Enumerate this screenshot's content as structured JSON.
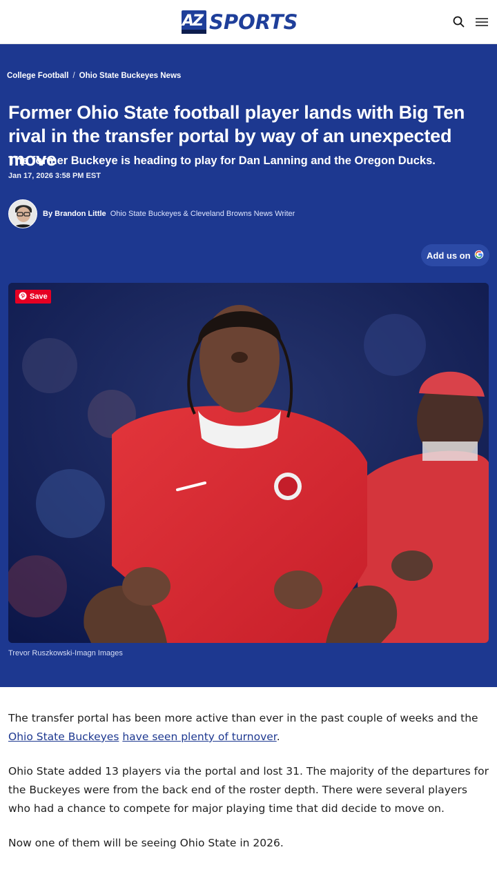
{
  "header": {
    "logo_mark": "AZ",
    "logo_word": "SPORTS",
    "search_icon": "search-icon",
    "menu_icon": "hamburger-menu-icon"
  },
  "breadcrumb": {
    "items": [
      "College Football",
      "Ohio State Buckeyes News"
    ],
    "separator": "/"
  },
  "article": {
    "headline": "Former Ohio State football player lands with Big Ten rival in the transfer portal by way of an unexpected move",
    "dek": "The former Buckeye is heading to play for Dan Lanning and the Oregon Ducks.",
    "dateline": "Jan 17, 2026 3:58 PM EST",
    "author_prefix": "By",
    "author_name": "Brandon Little",
    "author_role": "Ohio State Buckeyes & Cleveland Browns News Writer",
    "add_us_label": "Add us on",
    "save_label": "Save",
    "photo_credit": "Trevor Ruszkowski-Imagn Images",
    "p1_before": "The transfer portal has been more active than ever in the past couple of weeks and the ",
    "p1_link1": "Ohio State Buckeyes",
    "p1_mid": " ",
    "p1_link2": "have seen plenty of turnover",
    "p1_after": ".",
    "p2": "Ohio State added 13 players via the portal and lost 31. The majority of the departures for the Buckeyes were from the back end of the roster depth. There were several players who had a chance to compete for major playing time that did decide to move on.",
    "p3": "Now one of them will be seeing Ohio State in 2026."
  },
  "colors": {
    "brand_blue": "#1d3890",
    "pinterest_red": "#e60023",
    "link_blue": "#1d3890"
  }
}
